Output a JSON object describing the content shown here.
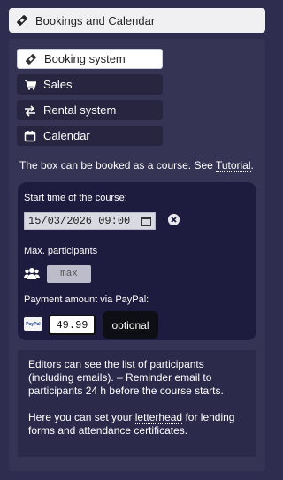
{
  "header": {
    "title": "Bookings and Calendar",
    "icon": "ticket-icon"
  },
  "nav": {
    "items": [
      {
        "label": "Booking system",
        "icon": "ticket-icon",
        "active": true
      },
      {
        "label": "Sales",
        "icon": "cart-icon",
        "active": false
      },
      {
        "label": "Rental system",
        "icon": "exchange-icon",
        "active": false
      },
      {
        "label": "Calendar",
        "icon": "calendar-icon",
        "active": false
      }
    ]
  },
  "info": {
    "text": "The box can be booked as a course. See ",
    "link": "Tutorial",
    "suffix": "."
  },
  "form": {
    "start_label": "Start time of the course:",
    "start_value": "15/03/2026 09:00",
    "max_label": "Max. participants",
    "max_placeholder": "max",
    "payment_label": "Payment amount via PayPal:",
    "paypal_text": "PayPal",
    "payment_value": "49.99",
    "optional_label": "optional"
  },
  "note": {
    "p1": "Editors can see the list of participants (including emails). – Reminder email to participants 24 h before the course starts.",
    "p2_pre": "Here you can set your ",
    "p2_link": "letterhead",
    "p2_post": " for lending forms and attendance certificates."
  },
  "colors": {
    "background": "#2e2c4f",
    "panel": "#363455",
    "card": "#1d1c3e",
    "active_tab": "#ffffff"
  }
}
